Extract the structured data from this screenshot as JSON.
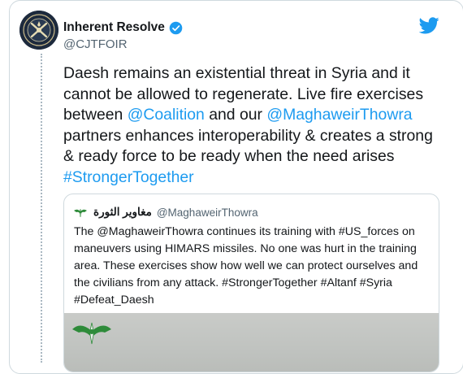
{
  "author": {
    "name": "Inherent Resolve",
    "handle": "@CJTFOIR",
    "verified": true,
    "avatar_icon": "cjtf-oir-seal-icon"
  },
  "tweet": {
    "segments": [
      {
        "text": "Daesh remains an existential threat in Syria and it cannot be allowed to regenerate. Live fire exercises between ",
        "type": "text"
      },
      {
        "text": "@Coalition",
        "type": "mention"
      },
      {
        "text": " and our ",
        "type": "text"
      },
      {
        "text": "@MaghaweirThowra",
        "type": "mention"
      },
      {
        "text": " partners enhances interoperability & creates a strong & ready force to be ready when the need arises ",
        "type": "text"
      },
      {
        "text": "#StrongerTogether",
        "type": "hashtag"
      }
    ]
  },
  "quoted": {
    "name": "مغاوير الثورة",
    "handle": "@MaghaweirThowra",
    "text": "The @MaghaweirThowra continues its training with #US_forces on maneuvers using HIMARS missiles. No one was hurt in the training area. These exercises show how well we can protect ourselves and the civilians from any attack. #StrongerTogether #Altanf #Syria #Defeat_Daesh",
    "avatar_icon": "maghaweir-emblem-icon",
    "image_icon": "maghaweir-emblem-icon"
  },
  "colors": {
    "link": "#1d9bf0",
    "text": "#14171a",
    "muted": "#536471",
    "border": "#cfd9de"
  },
  "brand_icon": "twitter-bird-icon"
}
